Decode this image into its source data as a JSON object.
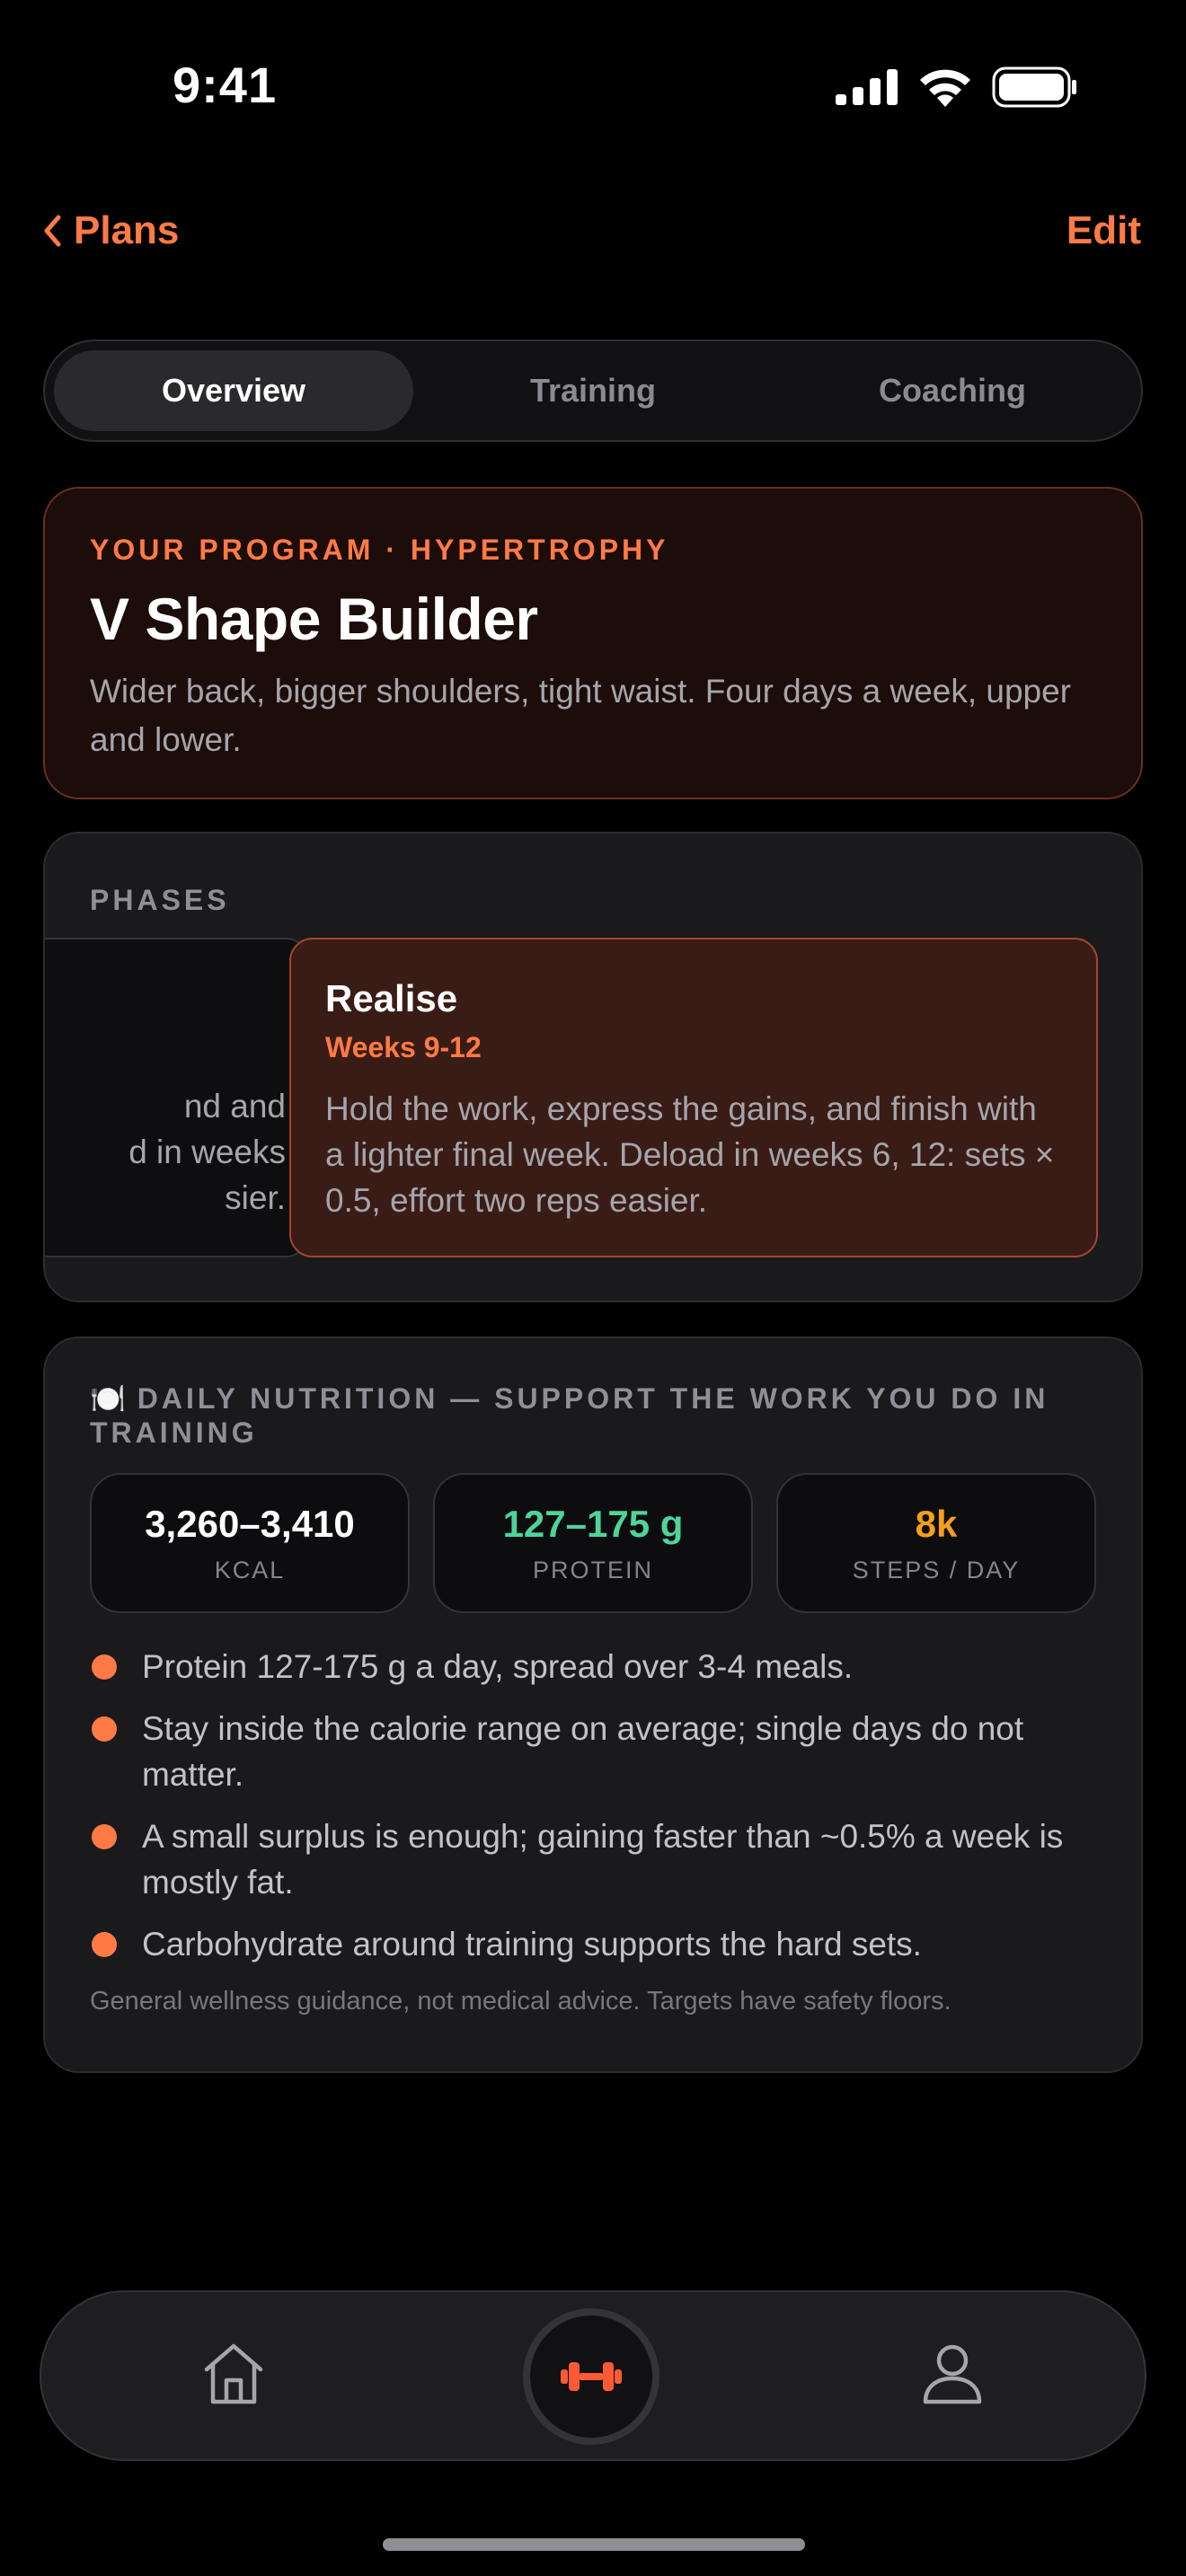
{
  "status_bar": {
    "time": "9:41"
  },
  "nav": {
    "back_label": "Plans",
    "edit_label": "Edit"
  },
  "tabs": [
    {
      "label": "Overview",
      "active": true
    },
    {
      "label": "Training",
      "active": false
    },
    {
      "label": "Coaching",
      "active": false
    }
  ],
  "program": {
    "eyebrow": "YOUR PROGRAM · HYPERTROPHY",
    "title": "V Shape Builder",
    "description": "Wider back, bigger shoulders, tight waist. Four days a week, upper and lower."
  },
  "phases": {
    "label": "PHASES",
    "previous_partial_text": "nd and\nd in weeks\nsier.",
    "active": {
      "name": "Realise",
      "weeks": "Weeks 9-12",
      "description": "Hold the work, express the gains, and finish with a lighter final week. Deload in weeks 6, 12: sets × 0.5, effort two reps easier."
    }
  },
  "nutrition": {
    "icon": "plate-cutlery-icon",
    "emoji": "🍽️",
    "title": "DAILY NUTRITION — SUPPORT THE WORK YOU DO IN TRAINING",
    "stats": [
      {
        "value": "3,260–3,410",
        "label": "KCAL",
        "color": "#ffffff"
      },
      {
        "value": "127–175 g",
        "label": "PROTEIN",
        "color": "#4fd39a"
      },
      {
        "value": "8k",
        "label": "STEPS / DAY",
        "color": "#f59e1b"
      }
    ],
    "bullets": [
      "Protein 127-175 g a day, spread over 3-4 meals.",
      "Stay inside the calorie range on average; single days do not matter.",
      "A small surplus is enough; gaining faster than ~0.5% a week is mostly fat.",
      "Carbohydrate around training supports the hard sets."
    ],
    "disclaimer": "General wellness guidance, not medical advice. Targets have safety floors."
  },
  "tab_bar": {
    "items": [
      {
        "icon": "home-icon"
      },
      {
        "icon": "dumbbell-icon",
        "active": true
      },
      {
        "icon": "profile-icon"
      }
    ]
  },
  "colors": {
    "accent": "#ff7a45",
    "protein": "#4fd39a",
    "steps": "#f59e1b",
    "background": "#000000"
  }
}
